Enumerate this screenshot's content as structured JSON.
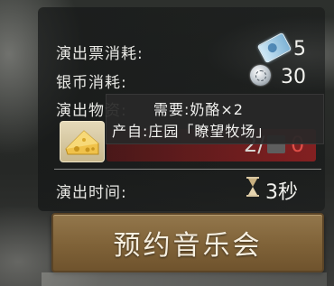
{
  "costs": {
    "ticket_label": "演出票消耗:",
    "ticket_value": "5",
    "silver_label": "银币消耗:",
    "silver_value": "30",
    "materials_label": "演出物资:"
  },
  "tooltip": {
    "need_line": "需要:奶酪×2",
    "source_line": "产自:庄园「瞭望牧场」"
  },
  "material": {
    "owned": "2/",
    "required": "0",
    "item_icon": "cheese-icon"
  },
  "duration": {
    "label": "演出时间:",
    "value": "3秒"
  },
  "action": {
    "button_label": "预约音乐会"
  },
  "colors": {
    "accent_gold": "#8a6c41",
    "warning_red": "#e04f48"
  }
}
